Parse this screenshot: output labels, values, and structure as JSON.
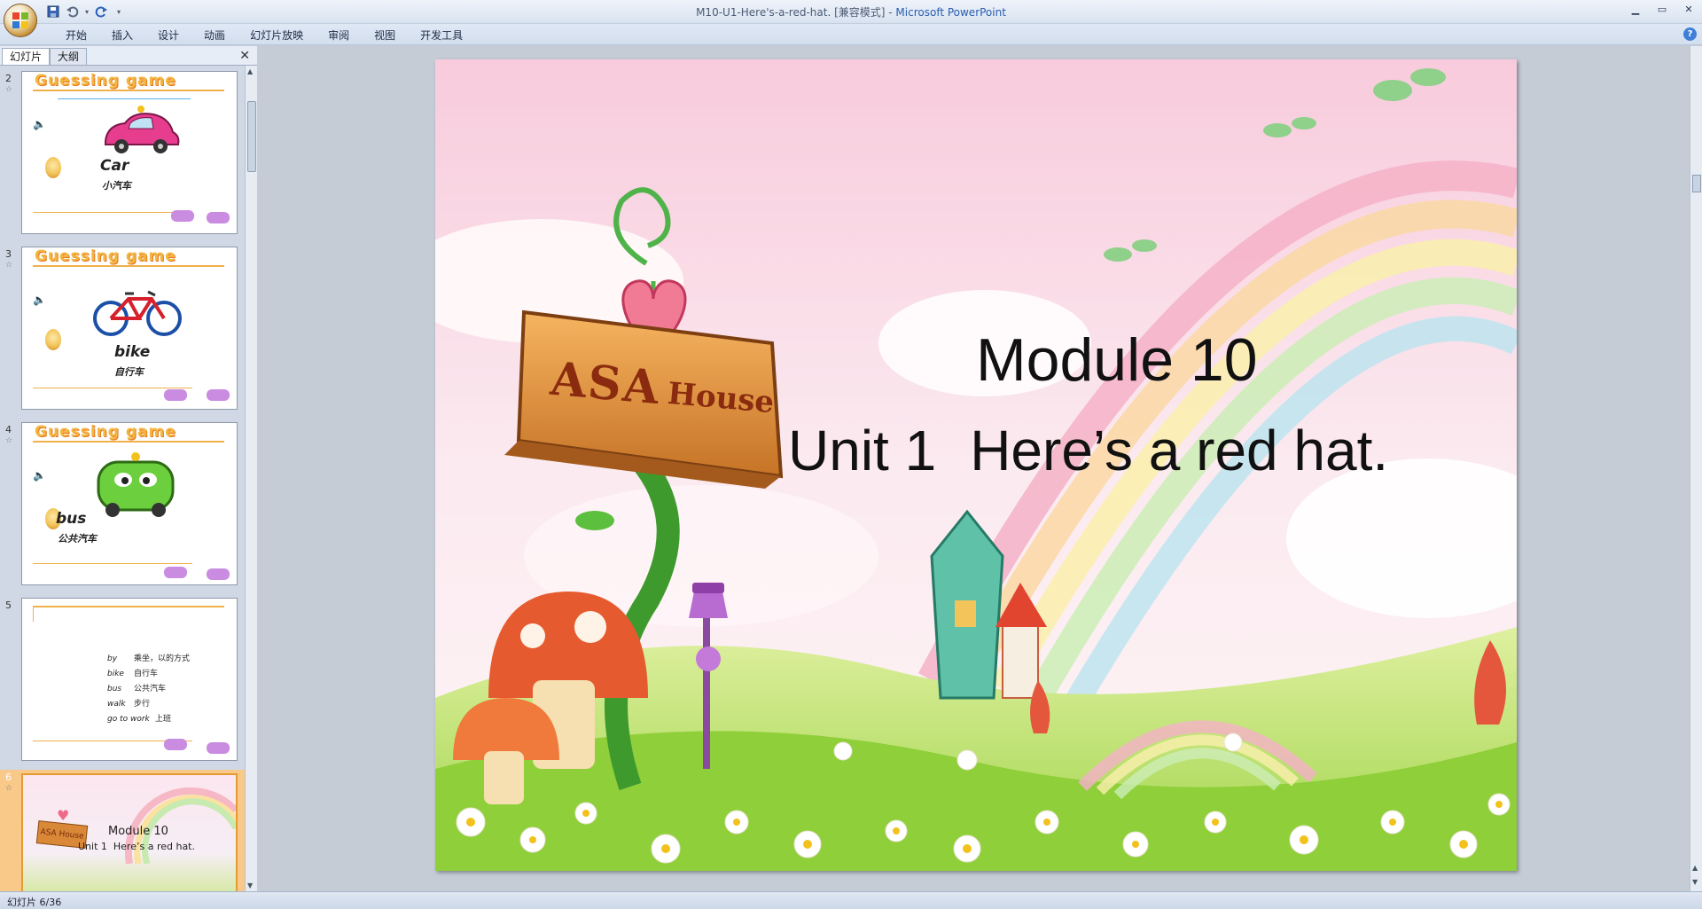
{
  "window": {
    "title": "M10-U1-Here's-a-red-hat. [兼容模式] - ",
    "app_name": "Microsoft PowerPoint"
  },
  "ribbon": {
    "tabs": [
      "开始",
      "插入",
      "设计",
      "动画",
      "幻灯片放映",
      "审阅",
      "视图",
      "开发工具"
    ]
  },
  "panel": {
    "tab_slides": "幻灯片",
    "tab_outline": "大纲",
    "close_glyph": "✕"
  },
  "thumbnails": [
    {
      "num": "2",
      "title": "Guessing game",
      "word": "Car",
      "cn": "小汽车"
    },
    {
      "num": "3",
      "title": "Guessing game",
      "word": "bike",
      "cn": "自行车"
    },
    {
      "num": "4",
      "title": "Guessing game",
      "word": "bus",
      "cn": "公共汽车"
    },
    {
      "num": "5",
      "vocab": [
        {
          "en": "by",
          "cn": "乘坐，以的方式"
        },
        {
          "en": "bike",
          "cn": "自行车"
        },
        {
          "en": "bus",
          "cn": "公共汽车"
        },
        {
          "en": "walk",
          "cn": "步行"
        },
        {
          "en": "go to work",
          "cn": "上班"
        }
      ]
    },
    {
      "num": "6",
      "sign_text": "ASA House",
      "line1": "Module 10",
      "line2_unit": "Unit 1",
      "line2_title": "Here’s a red hat."
    }
  ],
  "slide": {
    "sign_asa": "ASA",
    "sign_house": "House",
    "module": "Module 10",
    "unit": "Unit 1",
    "title": "Here’s a red hat."
  },
  "status": {
    "text": "幻灯片 6/36"
  },
  "colors": {
    "accent_orange": "#f2b640",
    "selected_thumb": "#e49b2f",
    "ribbon_bg": "#dfe8f5"
  }
}
